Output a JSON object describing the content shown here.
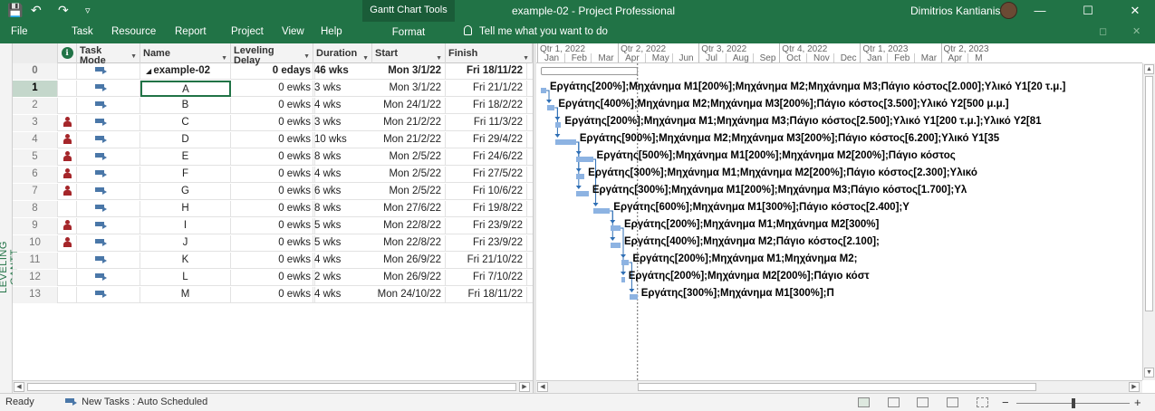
{
  "window": {
    "doc_title": "example-02  -  Project Professional",
    "user": "Dimitrios Kantianis",
    "context_group": "Gantt Chart Tools",
    "controls": [
      "—",
      "☐",
      "✕"
    ]
  },
  "ribbon": {
    "tabs": [
      "File",
      "Task",
      "Resource",
      "Report",
      "Project",
      "View",
      "Help"
    ],
    "context_tab": "Format",
    "tell_me": "Tell me what you want to do"
  },
  "view_label": "LEVELING GANTT",
  "columns": {
    "indicator": "ℹ",
    "task_mode": "Task Mode",
    "name": "Name",
    "leveling_delay": "Leveling Delay",
    "duration": "Duration",
    "start": "Start",
    "finish": "Finish"
  },
  "tasks": [
    {
      "id": "0",
      "person": false,
      "name": "example-02",
      "delay": "0 edays",
      "duration": "46 wks",
      "start": "Mon 3/1/22",
      "finish": "Fri 18/11/22",
      "summary": true,
      "label": ""
    },
    {
      "id": "1",
      "person": false,
      "name": "A",
      "delay": "0 ewks",
      "duration": "3 wks",
      "start": "Mon 3/1/22",
      "finish": "Fri 21/1/22",
      "selected": true,
      "label": "Εργάτης[200%];Μηχάνημα Μ1[200%];Μηχάνημα Μ2;Μηχάνημα Μ3;Πάγιο κόστος[2.000];Υλικό Υ1[20 τ.μ.]"
    },
    {
      "id": "2",
      "person": false,
      "name": "B",
      "delay": "0 ewks",
      "duration": "4 wks",
      "start": "Mon 24/1/22",
      "finish": "Fri 18/2/22",
      "label": "Εργάτης[400%];Μηχάνημα Μ2;Μηχάνημα Μ3[200%];Πάγιο κόστος[3.500];Υλικό Υ2[500 μ.μ.]"
    },
    {
      "id": "3",
      "person": true,
      "name": "C",
      "delay": "0 ewks",
      "duration": "3 wks",
      "start": "Mon 21/2/22",
      "finish": "Fri 11/3/22",
      "label": "Εργάτης[200%];Μηχάνημα Μ1;Μηχάνημα Μ3;Πάγιο κόστος[2.500];Υλικό Υ1[200 τ.μ.];Υλικό Υ2[81"
    },
    {
      "id": "4",
      "person": true,
      "name": "D",
      "delay": "0 ewks",
      "duration": "10 wks",
      "start": "Mon 21/2/22",
      "finish": "Fri 29/4/22",
      "label": "Εργάτης[900%];Μηχάνημα Μ2;Μηχάνημα Μ3[200%];Πάγιο κόστος[6.200];Υλικό Υ1[35"
    },
    {
      "id": "5",
      "person": true,
      "name": "E",
      "delay": "0 ewks",
      "duration": "8 wks",
      "start": "Mon 2/5/22",
      "finish": "Fri 24/6/22",
      "label": "Εργάτης[500%];Μηχάνημα Μ1[200%];Μηχάνημα Μ2[200%];Πάγιο κόστος"
    },
    {
      "id": "6",
      "person": true,
      "name": "F",
      "delay": "0 ewks",
      "duration": "4 wks",
      "start": "Mon 2/5/22",
      "finish": "Fri 27/5/22",
      "label": "Εργάτης[300%];Μηχάνημα Μ1;Μηχάνημα Μ2[200%];Πάγιο κόστος[2.300];Υλικό"
    },
    {
      "id": "7",
      "person": true,
      "name": "G",
      "delay": "0 ewks",
      "duration": "6 wks",
      "start": "Mon 2/5/22",
      "finish": "Fri 10/6/22",
      "label": "Εργάτης[300%];Μηχάνημα Μ1[200%];Μηχάνημα Μ3;Πάγιο κόστος[1.700];Υλ"
    },
    {
      "id": "8",
      "person": false,
      "name": "H",
      "delay": "0 ewks",
      "duration": "8 wks",
      "start": "Mon 27/6/22",
      "finish": "Fri 19/8/22",
      "label": "Εργάτης[600%];Μηχάνημα Μ1[300%];Πάγιο κόστος[2.400];Υ"
    },
    {
      "id": "9",
      "person": true,
      "name": "I",
      "delay": "0 ewks",
      "duration": "5 wks",
      "start": "Mon 22/8/22",
      "finish": "Fri 23/9/22",
      "label": "Εργάτης[200%];Μηχάνημα Μ1;Μηχάνημα Μ2[300%]"
    },
    {
      "id": "10",
      "person": true,
      "name": "J",
      "delay": "0 ewks",
      "duration": "5 wks",
      "start": "Mon 22/8/22",
      "finish": "Fri 23/9/22",
      "label": "Εργάτης[400%];Μηχάνημα Μ2;Πάγιο κόστος[2.100];"
    },
    {
      "id": "11",
      "person": false,
      "name": "K",
      "delay": "0 ewks",
      "duration": "4 wks",
      "start": "Mon 26/9/22",
      "finish": "Fri 21/10/22",
      "label": "Εργάτης[200%];Μηχάνημα Μ1;Μηχάνημα Μ2;"
    },
    {
      "id": "12",
      "person": false,
      "name": "L",
      "delay": "0 ewks",
      "duration": "2 wks",
      "start": "Mon 26/9/22",
      "finish": "Fri 7/10/22",
      "label": "Εργάτης[200%];Μηχάνημα Μ2[200%];Πάγιο κόστ"
    },
    {
      "id": "13",
      "person": false,
      "name": "M",
      "delay": "0 ewks",
      "duration": "4 wks",
      "start": "Mon 24/10/22",
      "finish": "Fri 18/11/22",
      "label": "Εργάτης[300%];Μηχάνημα Μ1[300%];Π"
    }
  ],
  "timescale": {
    "quarters": [
      "Qtr 1, 2022",
      "Qtr 2, 2022",
      "Qtr 3, 2022",
      "Qtr 4, 2022",
      "Qtr 1, 2023",
      "Qtr 2, 2023"
    ],
    "months": [
      "Jan",
      "Feb",
      "Mar",
      "Apr",
      "May",
      "Jun",
      "Jul",
      "Aug",
      "Sep",
      "Oct",
      "Nov",
      "Dec",
      "Jan",
      "Feb",
      "Mar",
      "Apr",
      "M"
    ]
  },
  "status": {
    "ready": "Ready",
    "new_tasks": "New Tasks : Auto Scheduled"
  },
  "colors": {
    "accent": "#217346",
    "bar": "#8db3e2",
    "person": "#a5262a"
  }
}
